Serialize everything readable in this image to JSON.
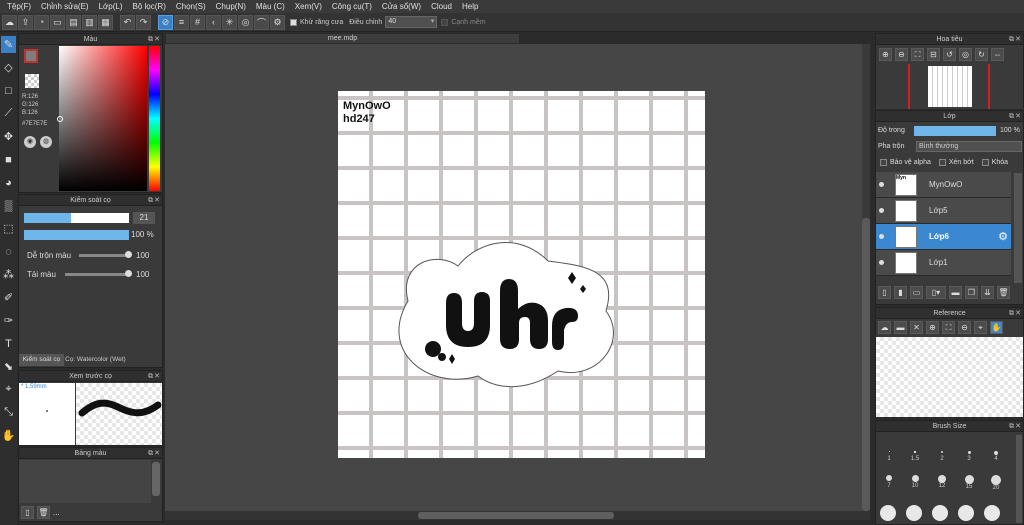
{
  "menu": [
    "Tệp(F)",
    "Chỉnh sửa(E)",
    "Lớp(L)",
    "Bộ lọc(R)",
    "Chọn(S)",
    "Chụp(N)",
    "Màu (C)",
    "Xem(V)",
    "Công cụ(T)",
    "Cửa sổ(W)",
    "Cloud",
    "Help"
  ],
  "toolbar": {
    "antialias_label": "Khử răng cưa",
    "adjust_label": "Điều chỉnh",
    "adjust_value": "40",
    "edge_label": "Cạnh mềm"
  },
  "color_panel": {
    "title": "Màu",
    "r": "R:126",
    "g": "G:126",
    "b": "B:126",
    "hex": "#7E7E7E",
    "fg_color": "#7e7e7e"
  },
  "brush_panel": {
    "title": "Kiểm soát cọ",
    "size_value": "21",
    "opacity_value": "100 %",
    "blend_label": "Dễ trộn màu",
    "blend_value": "100",
    "reload_label": "Tải màu",
    "reload_value": "100",
    "tab1": "Kiểm soát cọ",
    "tab2": "Cọ: Watercolor (Wet)"
  },
  "preview_panel": {
    "title": "Xem trước cọ",
    "size": "* 1.59mm"
  },
  "palette_panel": {
    "title": "Bảng màu",
    "more": "..."
  },
  "doc": {
    "tab": "mee.mdp",
    "text1": "MynOwO",
    "text2": "hd247"
  },
  "navigator": {
    "title": "Hoa tiêu"
  },
  "layers": {
    "title": "Lớp",
    "opacity_label": "Độ trong",
    "opacity_value": "100 %",
    "blend_label": "Pha trộn",
    "blend_value": "Bình thường",
    "protect_alpha": "Bảo vệ alpha",
    "clip": "Xén bớt",
    "lock": "Khóa",
    "items": [
      {
        "name": "MynOwO"
      },
      {
        "name": "Lớp5"
      },
      {
        "name": "Lớp6"
      },
      {
        "name": "Lớp1"
      }
    ]
  },
  "reference": {
    "title": "Reference"
  },
  "brush_size": {
    "title": "Brush Size",
    "row1": [
      "1",
      "1.5",
      "2",
      "3",
      "4"
    ],
    "row2": [
      "7",
      "10",
      "12",
      "15",
      "20"
    ]
  },
  "colors": {
    "accent": "#3b87d0",
    "panel": "#3a3a3a",
    "canvas": "#464646"
  }
}
